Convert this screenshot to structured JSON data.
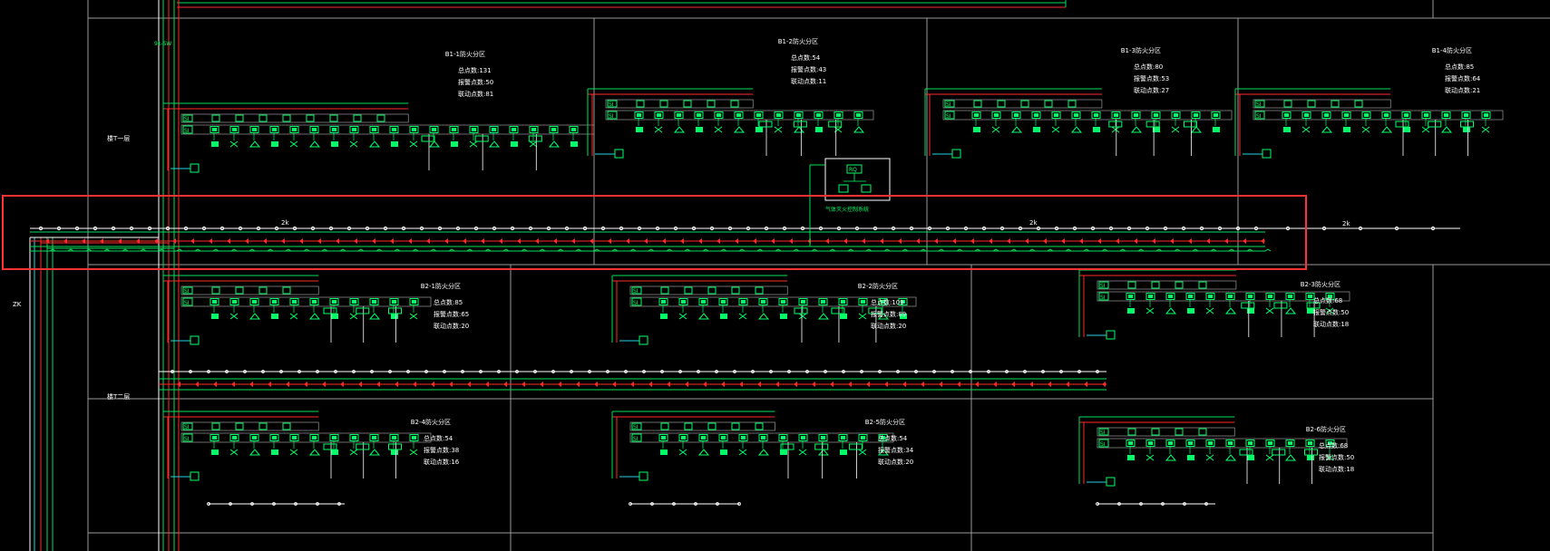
{
  "colors": {
    "background": "#000000",
    "frame": "#9a9a9a",
    "bus_white": "#ffffff",
    "bus_red": "#ff2a2a",
    "bus_green": "#00e05a",
    "signal_cyan": "#1fd6e6",
    "device_green": "#00ff66",
    "highlight": "#ff3333"
  },
  "floors": [
    {
      "name": "楼T一层",
      "zones": [
        {
          "name": "B1-1防火分区",
          "stats": [
            "总点数:131",
            "报警点数:50",
            "联动点数:81"
          ]
        },
        {
          "name": "B1-2防火分区",
          "stats": [
            "总点数:54",
            "报警点数:43",
            "联动点数:11"
          ]
        },
        {
          "name": "B1-3防火分区",
          "stats": [
            "总点数:80",
            "报警点数:53",
            "联动点数:27"
          ]
        },
        {
          "name": "B1-4防火分区",
          "stats": [
            "总点数:85",
            "报警点数:64",
            "联动点数:21"
          ]
        }
      ]
    },
    {
      "name": "楼T二层",
      "zones": [
        {
          "name": "B2-1防火分区",
          "stats": [
            "总点数:85",
            "报警点数:65",
            "联动点数:20"
          ]
        },
        {
          "name": "B2-2防火分区",
          "stats": [
            "总点数:109",
            "报警点数:89",
            "联动点数:20"
          ]
        },
        {
          "name": "B2-3防火分区",
          "stats": [
            "总点数:68",
            "报警点数:50",
            "联动点数:18"
          ]
        },
        {
          "name": "B2-4防火分区",
          "stats": [
            "总点数:54",
            "报警点数:38",
            "联动点数:16"
          ]
        },
        {
          "name": "B2-5防火分区",
          "stats": [
            "总点数:54",
            "报警点数:34",
            "联动点数:20"
          ]
        },
        {
          "name": "B2-6防火分区",
          "stats": [
            "总点数:68",
            "报警点数:50",
            "联动点数:18"
          ]
        }
      ]
    }
  ],
  "gas_box_label": "气体灭火控制系统",
  "gas_box_device": "RQ",
  "device_letters": {
    "input": "SI",
    "output": "SO"
  },
  "bus_tags": {
    "wire": "2k",
    "net": "ZK",
    "feeder": "9k-SW"
  },
  "highlight_note": ""
}
